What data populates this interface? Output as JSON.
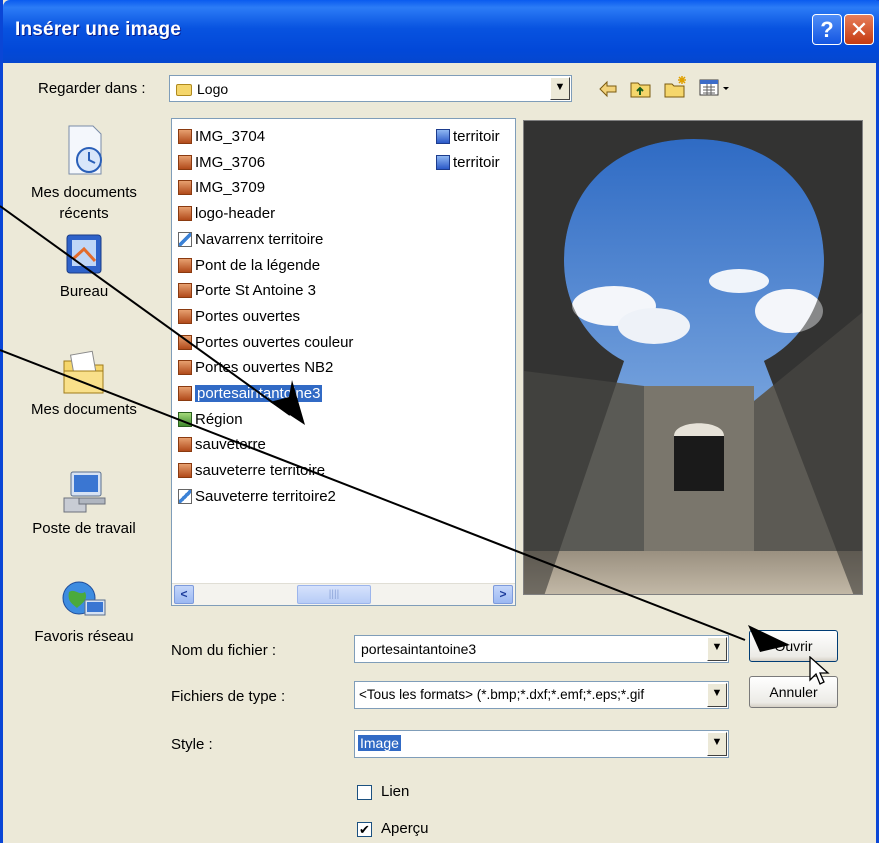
{
  "window": {
    "title": "Insérer une image",
    "help_label": "?",
    "close_label": "✕"
  },
  "lookin": {
    "label": "Regarder dans :",
    "value": "Logo"
  },
  "toolbar_icons": [
    "back-arrow-icon",
    "up-folder-icon",
    "new-folder-icon",
    "views-menu-icon"
  ],
  "places": [
    {
      "label": "Mes documents récents",
      "icon": "recent-documents-icon"
    },
    {
      "label": "Bureau",
      "icon": "desktop-icon"
    },
    {
      "label": "Mes documents",
      "icon": "my-documents-icon"
    },
    {
      "label": "Poste de travail",
      "icon": "my-computer-icon"
    },
    {
      "label": "Favoris réseau",
      "icon": "network-places-icon"
    }
  ],
  "files_col1": [
    {
      "name": "IMG_3704",
      "icon": "image-file-icon"
    },
    {
      "name": "IMG_3706",
      "icon": "image-file-icon"
    },
    {
      "name": "IMG_3709",
      "icon": "image-file-icon"
    },
    {
      "name": "logo-header",
      "icon": "image-file-icon"
    },
    {
      "name": "Navarrenx territoire",
      "icon": "drawing-file-icon"
    },
    {
      "name": "Pont de la légende",
      "icon": "image-file-icon"
    },
    {
      "name": "Porte St Antoine 3",
      "icon": "image-file-icon"
    },
    {
      "name": "Portes ouvertes",
      "icon": "image-file-icon"
    },
    {
      "name": "Portes ouvertes couleur",
      "icon": "image-file-icon"
    },
    {
      "name": "Portes ouvertes NB2",
      "icon": "image-file-icon"
    },
    {
      "name": "portesaintantoine3",
      "icon": "image-file-icon",
      "selected": true
    },
    {
      "name": "Région",
      "icon": "map-file-icon"
    },
    {
      "name": "sauveterre",
      "icon": "image-file-icon"
    },
    {
      "name": "sauveterre territoire",
      "icon": "image-file-icon"
    },
    {
      "name": "Sauveterre territoire2",
      "icon": "drawing-file-icon"
    }
  ],
  "files_col2": [
    {
      "name": "territoir",
      "icon": "bitmap-file-icon"
    },
    {
      "name": "territoir",
      "icon": "bitmap-file-icon"
    }
  ],
  "scrollbar": {
    "left": "<",
    "right": ">",
    "grip": "||||"
  },
  "filename": {
    "label": "Nom du fichier :",
    "value": "portesaintantoine3"
  },
  "filetype": {
    "label": "Fichiers de type :",
    "value": "<Tous les formats> (*.bmp;*.dxf;*.emf;*.eps;*.gif"
  },
  "style": {
    "label": "Style :",
    "value": "Image"
  },
  "lien": {
    "label": "Lien",
    "checked": false
  },
  "apercu": {
    "label": "Aperçu",
    "checked": true,
    "mark": "✔"
  },
  "buttons": {
    "open": "Ouvrir",
    "cancel": "Annuler"
  },
  "colors": {
    "titlebar": "#0A53E0",
    "dialog_bg": "#ECE9D8",
    "selection": "#316AC5",
    "close_button": "#C53A11"
  }
}
